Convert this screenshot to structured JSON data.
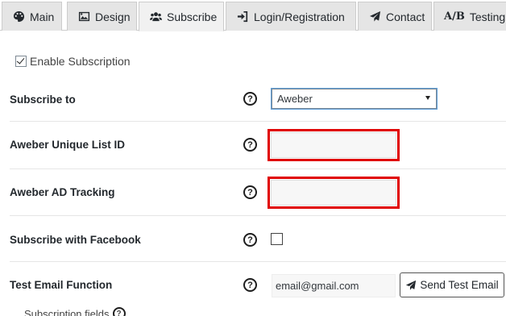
{
  "tabs": [
    {
      "label": "Main",
      "icon": "palette-icon"
    },
    {
      "label": "Design",
      "icon": "image-icon"
    },
    {
      "label": "Subscribe",
      "icon": "users-icon",
      "active": true
    },
    {
      "label": "Login/Registration",
      "icon": "sign-in-icon"
    },
    {
      "label": "Contact",
      "icon": "paper-plane-icon"
    },
    {
      "label": "Testing",
      "prefix": "A/B"
    }
  ],
  "enable_subscription": {
    "label": "Enable Subscription",
    "checked": true
  },
  "rows": {
    "subscribe_to": {
      "label": "Subscribe to",
      "help": "?"
    },
    "list_id": {
      "label": "Aweber Unique List ID",
      "help": "?",
      "value": ""
    },
    "ad_tracking": {
      "label": "Aweber AD Tracking",
      "help": "?",
      "value": ""
    },
    "facebook": {
      "label": "Subscribe with Facebook",
      "help": "?",
      "checked": false
    },
    "test_email": {
      "label": "Test Email Function",
      "help": "?"
    }
  },
  "subscribe_select": {
    "value": "Aweber"
  },
  "test_email_input": {
    "value": "email@gmail.com"
  },
  "send_button": {
    "label": "Send Test Email",
    "icon": "paper-plane-icon"
  },
  "subscription_fields": {
    "label": "Subscription fields",
    "help": "?"
  },
  "colors": {
    "highlight": "#e00000",
    "tab_bg": "#e5e5e5",
    "tab_active_bg": "#f1f1f1"
  }
}
